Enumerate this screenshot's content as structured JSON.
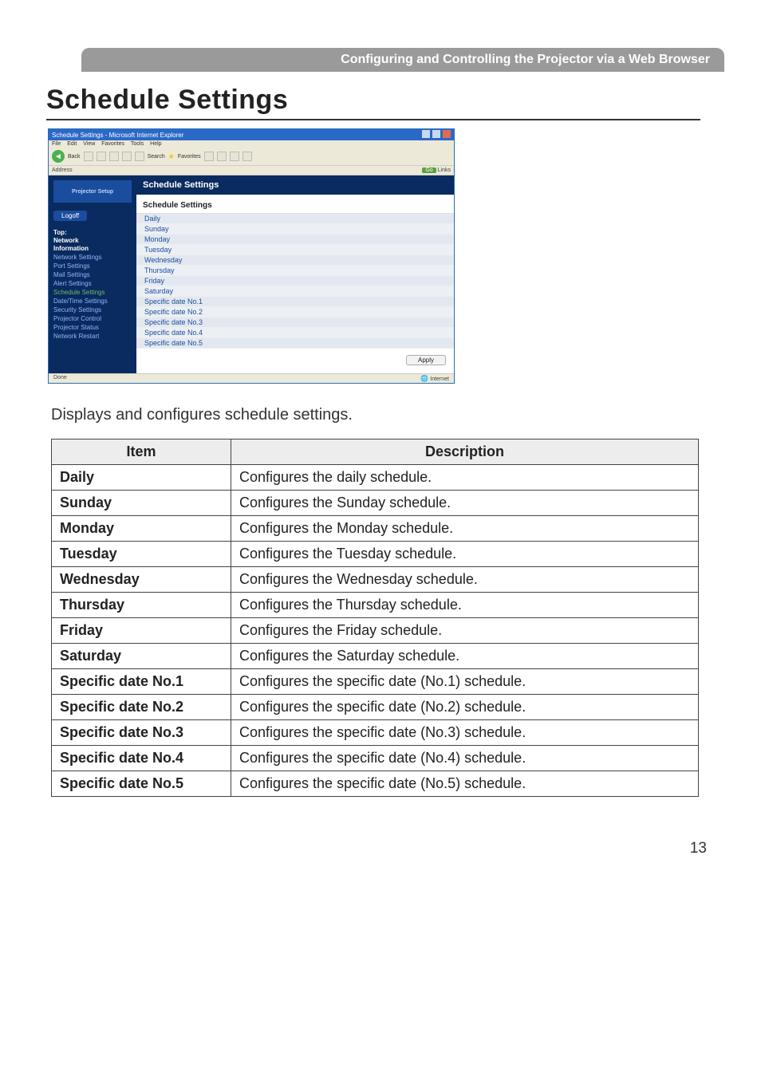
{
  "header_bar": "Configuring and Controlling the Projector via a Web Browser",
  "page_title": "Schedule Settings",
  "intro_text": "Displays and configures schedule settings.",
  "table_headers": {
    "item": "Item",
    "description": "Description"
  },
  "table_rows": [
    {
      "item": "Daily",
      "description": "Configures the daily schedule."
    },
    {
      "item": "Sunday",
      "description": "Configures the Sunday schedule."
    },
    {
      "item": "Monday",
      "description": "Configures the Monday schedule."
    },
    {
      "item": "Tuesday",
      "description": "Configures the Tuesday schedule."
    },
    {
      "item": "Wednesday",
      "description": "Configures the Wednesday schedule."
    },
    {
      "item": "Thursday",
      "description": "Configures the Thursday schedule."
    },
    {
      "item": "Friday",
      "description": "Configures the Friday schedule."
    },
    {
      "item": "Saturday",
      "description": "Configures the Saturday schedule."
    },
    {
      "item": "Specific date No.1",
      "description": "Configures the specific date (No.1) schedule."
    },
    {
      "item": "Specific date No.2",
      "description": "Configures the specific date (No.2) schedule."
    },
    {
      "item": "Specific date No.3",
      "description": "Configures the specific date (No.3) schedule."
    },
    {
      "item": "Specific date No.4",
      "description": "Configures the specific date (No.4) schedule."
    },
    {
      "item": "Specific date No.5",
      "description": "Configures the specific date (No.5) schedule."
    }
  ],
  "page_number": "13",
  "screenshot": {
    "titlebar": "Schedule Settings - Microsoft Internet Explorer",
    "menus": [
      "File",
      "Edit",
      "View",
      "Favorites",
      "Tools",
      "Help"
    ],
    "toolbar": {
      "back": "Back",
      "search": "Search",
      "favorites": "Favorites"
    },
    "address_label": "Address",
    "go_label": "Go",
    "links_label": "Links",
    "sidebar": {
      "setup_label": "Projector Setup",
      "logoff": "Logoff",
      "groups": [
        "Top:",
        "Network",
        "Information"
      ],
      "items": [
        {
          "label": "Network Settings",
          "selected": false
        },
        {
          "label": "Port Settings",
          "selected": false
        },
        {
          "label": "Mail Settings",
          "selected": false
        },
        {
          "label": "Alert Settings",
          "selected": false
        },
        {
          "label": "Schedule Settings",
          "selected": true
        },
        {
          "label": "Date/Time Settings",
          "selected": false
        },
        {
          "label": "Security Settings",
          "selected": false
        },
        {
          "label": "Projector Control",
          "selected": false
        },
        {
          "label": "Projector Status",
          "selected": false
        },
        {
          "label": "Network Restart",
          "selected": false
        }
      ]
    },
    "main": {
      "header": "Schedule Settings",
      "subheader": "Schedule Settings",
      "rows": [
        "Daily",
        "Sunday",
        "Monday",
        "Tuesday",
        "Wednesday",
        "Thursday",
        "Friday",
        "Saturday",
        "Specific date No.1",
        "Specific date No.2",
        "Specific date No.3",
        "Specific date No.4",
        "Specific date No.5"
      ],
      "apply_btn": "Apply"
    },
    "statusbar": {
      "done": "Done",
      "zone": "Internet"
    }
  }
}
